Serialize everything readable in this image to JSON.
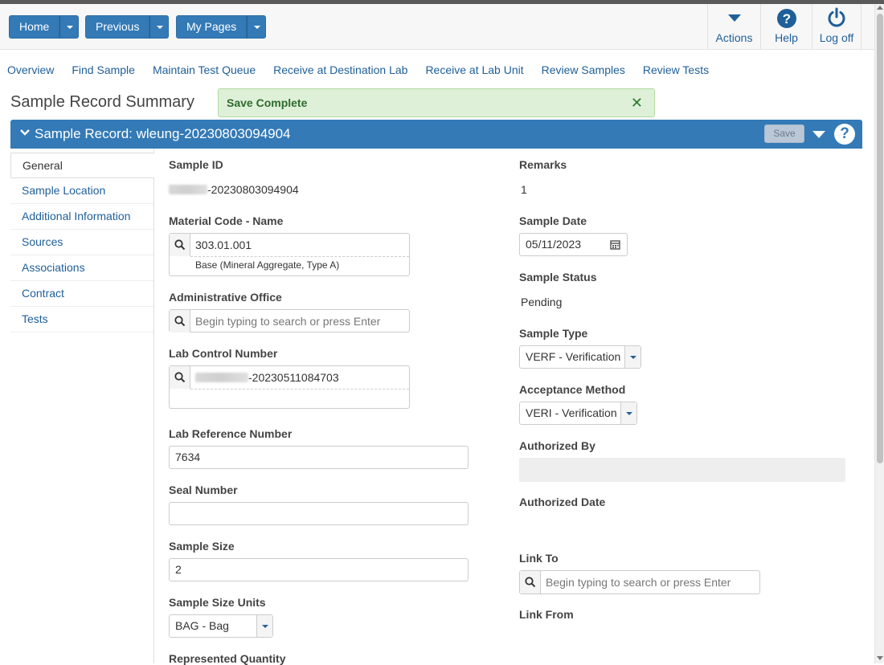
{
  "topnav": {
    "home_label": "Home",
    "previous_label": "Previous",
    "mypages_label": "My Pages",
    "actions_label": "Actions",
    "help_label": "Help",
    "logoff_label": "Log off",
    "icons": [
      "chevron-down-icon",
      "help-icon",
      "power-icon"
    ]
  },
  "tabs": [
    "Overview",
    "Find Sample",
    "Maintain Test Queue",
    "Receive at Destination Lab",
    "Receive at Lab Unit",
    "Review Samples",
    "Review Tests"
  ],
  "page": {
    "title": "Sample Record Summary",
    "alert_text": "Save Complete",
    "alert_close": "✕"
  },
  "panel": {
    "title": "Sample Record: wleung-20230803094904",
    "save_label": "Save",
    "help_glyph": "?"
  },
  "sidebar": {
    "items": [
      "General",
      "Sample Location",
      "Additional Information",
      "Sources",
      "Associations",
      "Contract",
      "Tests"
    ]
  },
  "form": {
    "sample_id_label": "Sample ID",
    "sample_id_value": "-20230803094904",
    "material_label": "Material Code - Name",
    "material_code": "303.01.001",
    "material_name": "Base (Mineral Aggregate, Type A)",
    "admin_office_label": "Administrative Office",
    "admin_office_placeholder": "Begin typing to search or press Enter",
    "lab_control_label": "Lab Control Number",
    "lab_control_value": "-20230511084703",
    "lab_ref_label": "Lab Reference Number",
    "lab_ref_value": "7634",
    "seal_label": "Seal Number",
    "seal_value": "",
    "sample_size_label": "Sample Size",
    "sample_size_value": "2",
    "sample_units_label": "Sample Size Units",
    "sample_units_value": "BAG - Bag",
    "represented_label": "Represented Quantity",
    "remarks_label": "Remarks",
    "remarks_value": "1",
    "sample_date_label": "Sample Date",
    "sample_date_value": "05/11/2023",
    "status_label": "Sample Status",
    "status_value": "Pending",
    "type_label": "Sample Type",
    "type_value": "VERF - Verification",
    "acceptance_label": "Acceptance Method",
    "acceptance_value": "VERI - Verification",
    "authorized_by_label": "Authorized By",
    "authorized_date_label": "Authorized Date",
    "link_to_label": "Link To",
    "link_to_placeholder": "Begin typing to search or press Enter",
    "link_from_label": "Link From"
  },
  "colors": {
    "primary": "#337ab7",
    "link": "#1f5f99",
    "alert_bg": "#dff0d8",
    "alert_text": "#2e6b2e"
  }
}
